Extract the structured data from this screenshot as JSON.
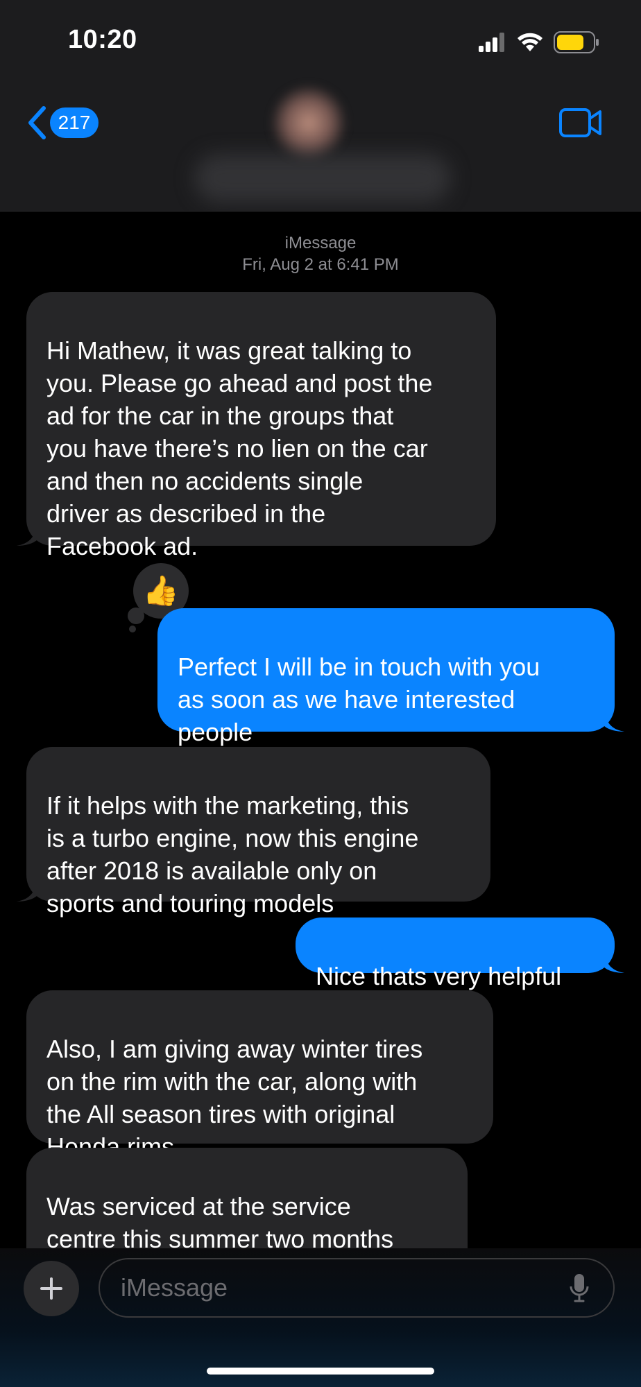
{
  "status_bar": {
    "time": "10:20"
  },
  "header": {
    "back_count": "217"
  },
  "conversation": {
    "service": "iMessage",
    "timestamp": "Fri, Aug 2 at 6:41 PM",
    "messages": [
      {
        "direction": "incoming",
        "text": "Hi Mathew, it was great talking to\nyou. Please go ahead and post the\nad for the car in the groups that\nyou have there’s no lien on the car\nand then no accidents single\ndriver as described in the\nFacebook ad."
      },
      {
        "direction": "outgoing",
        "text": "Perfect I will be in touch with you\nas soon as we have interested\npeople",
        "reaction": "👍"
      },
      {
        "direction": "incoming",
        "text": "If it helps with the marketing, this\nis a turbo engine, now this engine\nafter 2018 is available only on\nsports and touring models"
      },
      {
        "direction": "outgoing",
        "text": "Nice thats very helpful"
      },
      {
        "direction": "incoming",
        "text": "Also, I am giving away winter tires\non the rim with the car, along with\nthe All season tires with original\nHonda rims"
      },
      {
        "direction": "incoming",
        "text": "Was serviced at the service\ncentre this summer two months\nago, the car was fully interior"
      }
    ]
  },
  "composer": {
    "placeholder": "iMessage"
  },
  "colors": {
    "accent": "#0a84ff",
    "incoming_bubble": "#262628",
    "battery": "#ffd60a"
  },
  "icons": [
    "signal-icon",
    "wifi-icon",
    "battery-icon",
    "back-chevron-icon",
    "video-camera-icon",
    "plus-icon",
    "microphone-icon"
  ]
}
